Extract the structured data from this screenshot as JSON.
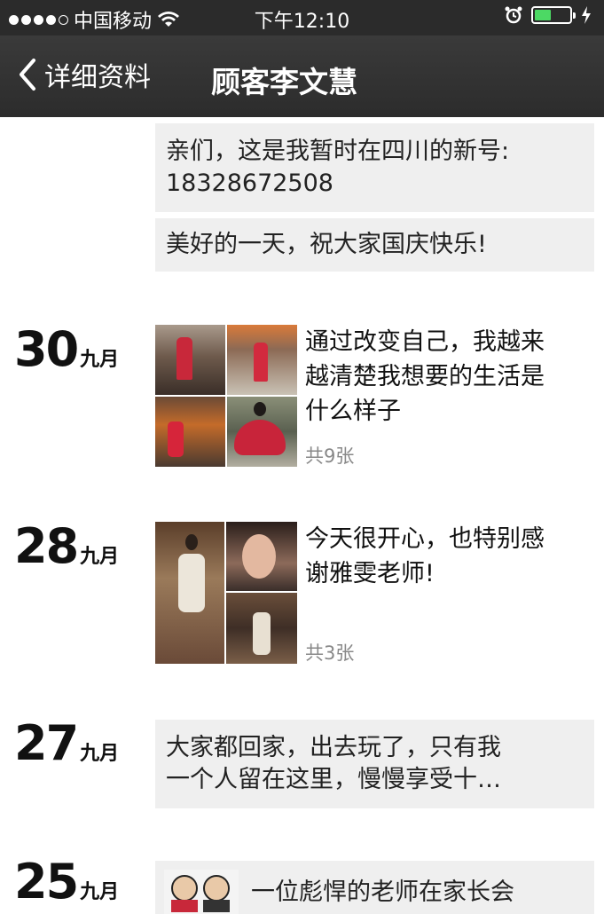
{
  "status_bar": {
    "carrier": "中国移动",
    "time": "下午12:10"
  },
  "nav": {
    "back_label": "详细资料",
    "title": "顾客李文慧"
  },
  "feed": {
    "top_posts": [
      {
        "text_line1": "亲们，这是我暂时在四川的新号:",
        "text_line2": "18328672508"
      },
      {
        "text": "美好的一天，祝大家国庆快乐!"
      }
    ],
    "entries": [
      {
        "day": "30",
        "month": "九月",
        "text_lines": [
          "通过改变自己，我越来",
          "越清楚我想要的生活是",
          "什么样子"
        ],
        "photo_count": "共9张"
      },
      {
        "day": "28",
        "month": "九月",
        "text_lines": [
          "今天很开心，也特别感",
          "谢雅雯老师!"
        ],
        "photo_count": "共3张"
      },
      {
        "day": "27",
        "month": "九月",
        "text_lines": [
          "大家都回家，出去玩了，只有我",
          "一个人留在这里，慢慢享受十…"
        ]
      },
      {
        "day": "25",
        "month": "九月",
        "text_lines": [
          "一位彪悍的老师在家长会"
        ]
      }
    ]
  },
  "colors": {
    "bar_bg": "#2c2c2c",
    "bubble_bg": "#efefef",
    "battery_green": "#4cd964"
  }
}
